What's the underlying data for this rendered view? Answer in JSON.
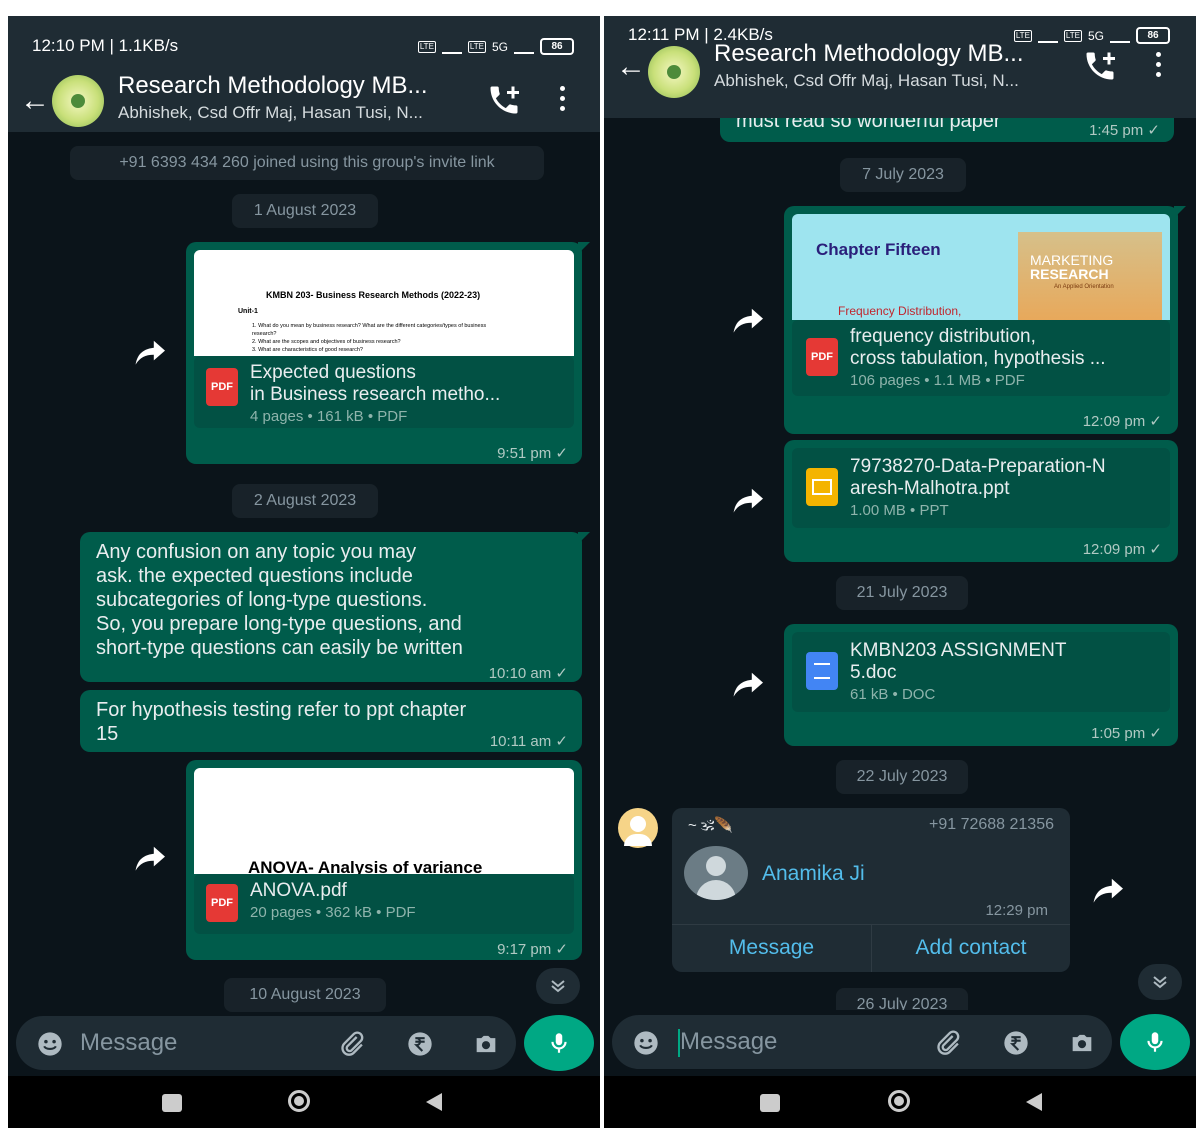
{
  "left": {
    "status": {
      "time": "12:10 PM | 1.1KB/s",
      "battery": "86",
      "net": "5G"
    },
    "header": {
      "title": "Research Methodology MB...",
      "subtitle": "Abhishek, Csd Offr Maj, Hasan Tusi, N..."
    },
    "system_msg": "+91 6393 434 260 joined using this group's invite link",
    "date1": "1 August 2023",
    "doc1": {
      "preview_title": "KMBN 203- Business Research Methods (2022-23)",
      "preview_unit": "Unit-1",
      "preview_items": [
        "1. What do you mean by business research? What are the different categories/types of business research?",
        "2. What are the scopes and objectives of business research?",
        "3. What are characteristics of good research?"
      ],
      "name_line1": "Expected questions",
      "name_line2": "in Business research metho...",
      "meta": "4 pages • 161 kB • PDF",
      "time": "9:51 pm ✓"
    },
    "date2": "2 August 2023",
    "msg1": {
      "lines": [
        "Any confusion on any topic you may",
        "ask. the expected questions include",
        "subcategories of long-type questions.",
        "So, you prepare long-type questions, and",
        "short-type questions can easily be written"
      ],
      "time": "10:10 am ✓"
    },
    "msg2": {
      "line1": "For hypothesis testing refer to ppt chapter",
      "line2": "15",
      "time": "10:11 am ✓"
    },
    "doc2": {
      "preview_title": "ANOVA- Analysis of variance",
      "name": "ANOVA.pdf",
      "meta": "20 pages • 362 kB • PDF",
      "time": "9:17 pm ✓"
    },
    "date3": "10 August 2023",
    "composer": {
      "placeholder": "Message"
    }
  },
  "right": {
    "status": {
      "time": "12:11 PM | 2.4KB/s",
      "battery": "86",
      "net": "5G"
    },
    "header": {
      "title": "Research Methodology MB...",
      "subtitle": "Abhishek, Csd Offr Maj, Hasan Tusi, N..."
    },
    "partial_msg": {
      "text": "must read so wonderful paper",
      "time": "1:45 pm ✓"
    },
    "date1": "7 July 2023",
    "doc1": {
      "preview_chapter": "Chapter Fifteen",
      "preview_sub": "Frequency Distribution,",
      "book_title1": "MARKETING",
      "book_title2": "RESEARCH",
      "book_sub": "An Applied Orientation",
      "name_line1": "frequency distribution,",
      "name_line2": "cross tabulation, hypothesis ...",
      "meta": "106 pages • 1.1 MB • PDF",
      "time": "12:09 pm ✓"
    },
    "doc2": {
      "name_line1": "79738270-Data-Preparation-N",
      "name_line2": "aresh-Malhotra.ppt",
      "meta": "1.00 MB • PPT",
      "time": "12:09 pm ✓"
    },
    "date2": "21 July 2023",
    "doc3": {
      "name_line1": "KMBN203 ASSIGNMENT",
      "name_line2": "5.doc",
      "meta": "61 kB • DOC",
      "time": "1:05 pm ✓"
    },
    "date3": "22 July 2023",
    "contact_msg": {
      "sender_name": "~ 🕉🪶",
      "sender_phone": "+91 72688 21356",
      "contact_name": "Anamika Ji",
      "time": "12:29 pm",
      "btn_message": "Message",
      "btn_add": "Add contact"
    },
    "date4": "26 July 2023",
    "composer": {
      "placeholder": "Message"
    }
  },
  "colors": {
    "bg": "#0b141a",
    "header": "#1f2c34",
    "outgoing": "#005c4b",
    "incoming": "#1f2c34",
    "accent": "#00a884",
    "link": "#53bdeb"
  },
  "icons": [
    "back-arrow-icon",
    "add-call-icon",
    "more-vert-icon",
    "forward-icon",
    "pdf-icon",
    "ppt-icon",
    "doc-icon",
    "emoji-icon",
    "attach-icon",
    "rupee-icon",
    "camera-icon",
    "mic-icon",
    "scroll-down-icon",
    "nav-square-icon",
    "nav-home-icon",
    "nav-back-icon"
  ]
}
